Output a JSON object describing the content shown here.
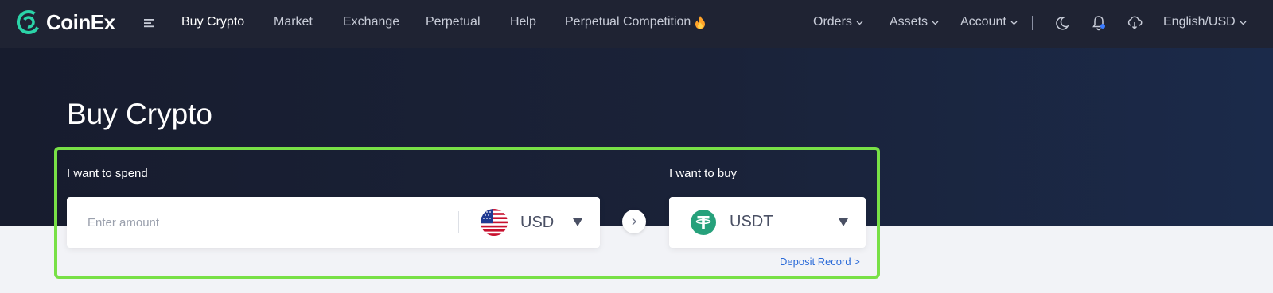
{
  "brand": {
    "name": "CoinEx",
    "logo_icon": "coinex-logo-icon"
  },
  "nav": {
    "menu_icon": "hamburger-menu-icon",
    "links": [
      {
        "label": "Buy Crypto",
        "active": true
      },
      {
        "label": "Market",
        "active": false
      },
      {
        "label": "Exchange",
        "active": false
      },
      {
        "label": "Perpetual",
        "active": false
      },
      {
        "label": "Help",
        "active": false
      },
      {
        "label": "Perpetual Competition",
        "active": false,
        "suffix_icon": "fire-icon"
      }
    ],
    "right": {
      "orders_label": "Orders",
      "assets_label": "Assets",
      "account_label": "Account",
      "separator": "|",
      "theme_icon": "moon-icon",
      "notification_icon": "bell-icon",
      "download_icon": "cloud-download-icon",
      "language_label": "English/USD"
    }
  },
  "page": {
    "title": "Buy Crypto"
  },
  "spend": {
    "label": "I want to spend",
    "placeholder": "Enter amount",
    "value": "",
    "currency": "USD",
    "currency_icon": "us-flag-icon"
  },
  "buy": {
    "label": "I want to buy",
    "currency": "USDT",
    "currency_icon": "tether-icon"
  },
  "arrow_icon": "chevron-right-icon",
  "deposit_record_label": "Deposit Record >",
  "colors": {
    "nav_bg": "#1f2333",
    "hero_bg": "#171c2e",
    "highlight_border": "#78e046",
    "link_blue": "#2a6ad8",
    "tether_green": "#26a17b",
    "page_bg": "#f2f3f7"
  }
}
